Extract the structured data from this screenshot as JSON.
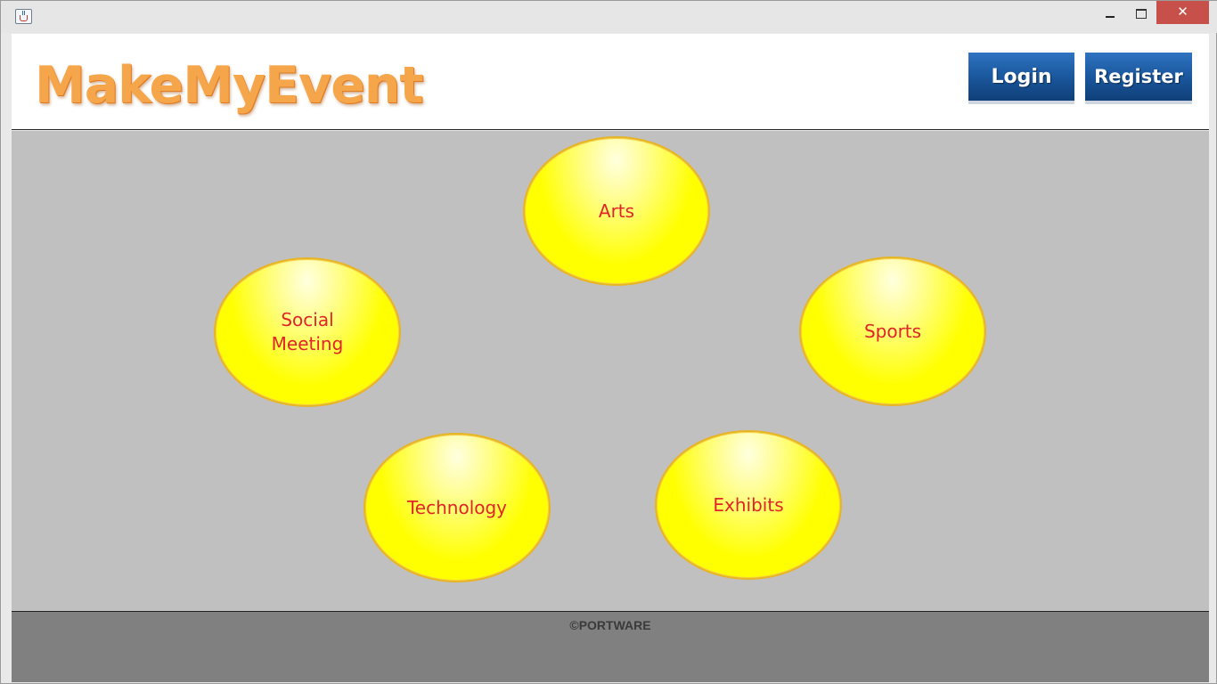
{
  "window": {
    "close_glyph": "✕"
  },
  "header": {
    "logo_text": "MakeMyEvent",
    "login_label": "Login",
    "register_label": "Register"
  },
  "categories": [
    {
      "label": "Arts"
    },
    {
      "label": "Social\nMeeting"
    },
    {
      "label": "Sports"
    },
    {
      "label": "Technology"
    },
    {
      "label": "Exhibits"
    }
  ],
  "footer": {
    "copyright": "©PORTWARE"
  },
  "colors": {
    "bubble_fill": "#ffff00",
    "bubble_text": "#e0242a",
    "main_bg": "#c0c0c0",
    "footer_bg": "#808080",
    "button_blue": "#1c5aa1",
    "logo_orange": "#f5a54a",
    "close_red": "#c7504b"
  },
  "icons": {
    "app": "java-cup-icon",
    "minimize": "minimize-icon",
    "maximize": "maximize-icon",
    "close": "close-icon"
  }
}
